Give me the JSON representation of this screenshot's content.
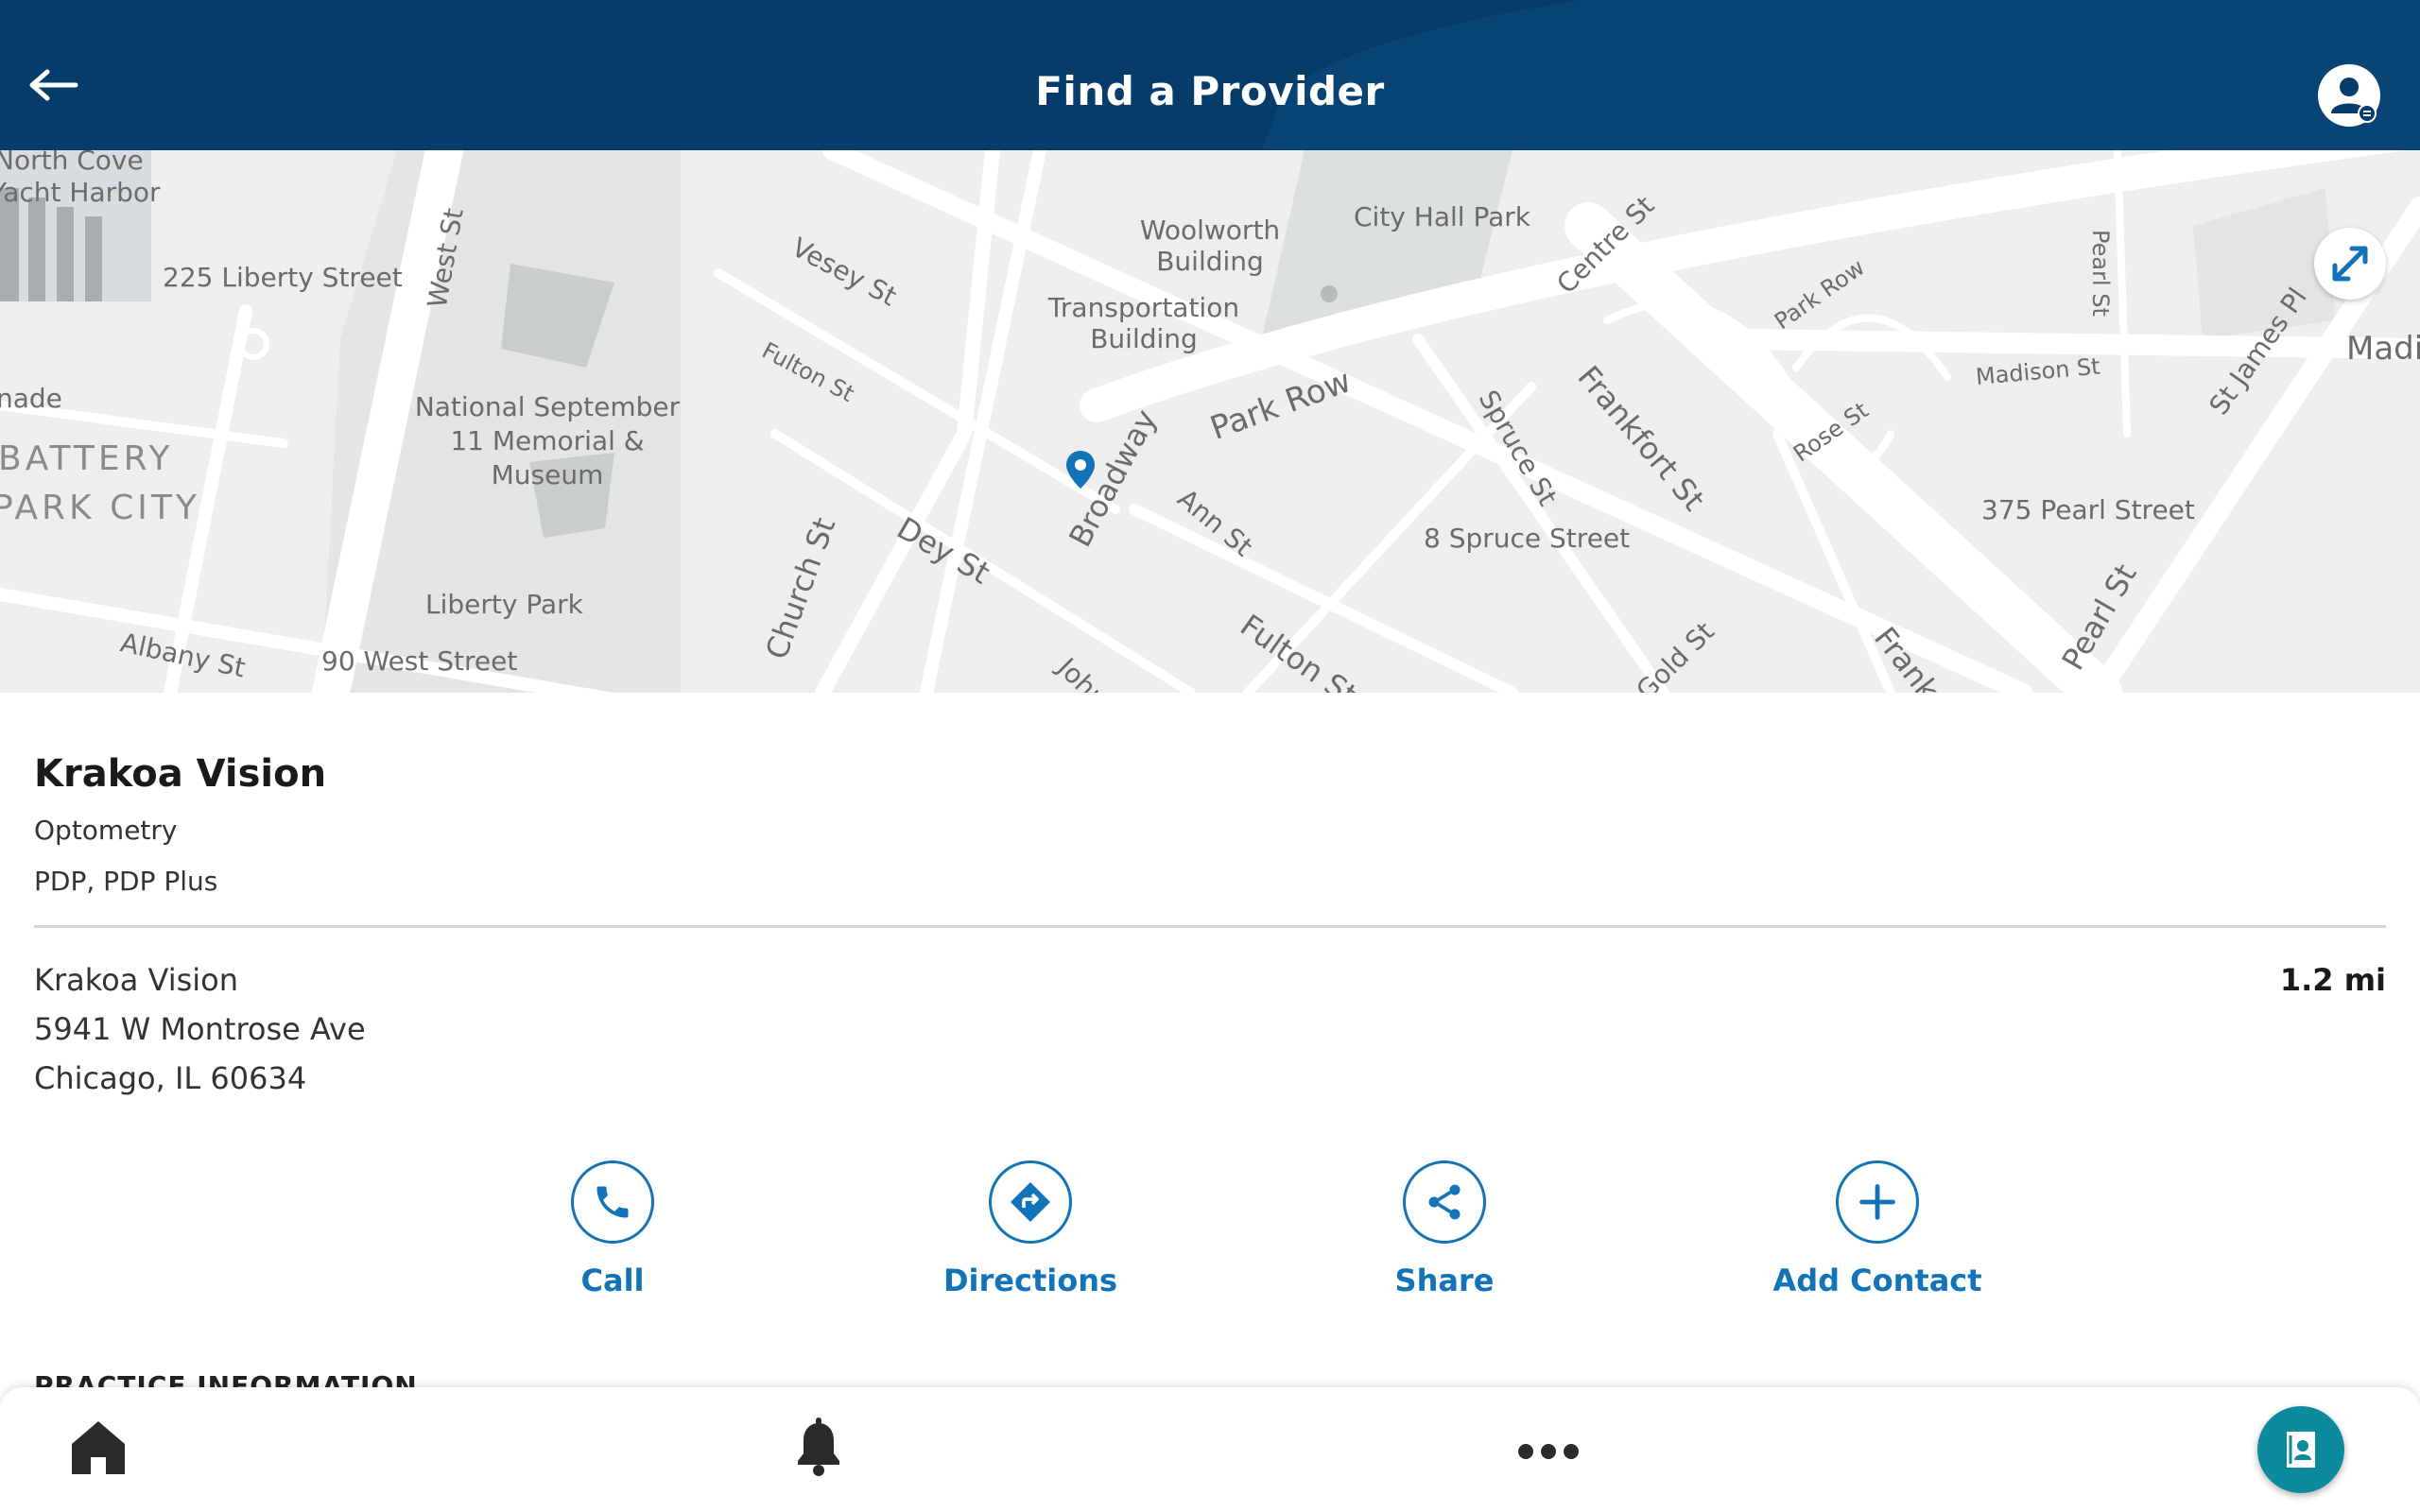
{
  "header": {
    "title": "Find a Provider"
  },
  "map": {
    "labels": {
      "north_cove": "North Cove",
      "yacht_harbor": "Yacht Harbor",
      "liberty_225": "225 Liberty Street",
      "west_st": "West St",
      "vesey_st": "Vesey St",
      "fulton_st_1": "Fulton St",
      "woolworth": "Woolworth Building",
      "transportation": "Transportation Building",
      "city_hall_park": "City Hall Park",
      "centre_st": "Centre St",
      "park_row_1": "Park Row",
      "park_row_2": "Park Row",
      "pearl_st_1": "Pearl St",
      "madison_st": "Madison St",
      "st_james": "St James Pl",
      "madi": "Madi",
      "frankfort_st_1": "Frankfort St",
      "rose_st": "Rose St",
      "spruce_st": "Spruce St",
      "nade": "nade",
      "battery": "BATTERY",
      "park_city": "PARK CITY",
      "memorial": "National September 11 Memorial & Museum",
      "liberty_park": "Liberty Park",
      "albany_st": "Albany St",
      "west_90": "90 West Street",
      "church_st": "Church St",
      "dey_st": "Dey St",
      "broadway": "Broadway",
      "ann_st": "Ann St",
      "spruce_8": "8 Spruce Street",
      "fulton_st_2": "Fulton St",
      "john": "John",
      "gold_st": "Gold St",
      "frankfort_2": "Frankfo",
      "pearl_375": "375 Pearl Street",
      "pearl_st_2": "Pearl St"
    }
  },
  "provider": {
    "name": "Krakoa Vision",
    "specialty": "Optometry",
    "networks": "PDP, PDP Plus",
    "location_name": "Krakoa Vision",
    "address_line1": "5941 W Montrose Ave",
    "address_line2": "Chicago, IL 60634",
    "distance": "1.2 mi"
  },
  "actions": {
    "call": "Call",
    "directions": "Directions",
    "share": "Share",
    "add_contact": "Add Contact"
  },
  "section": {
    "practice_info": "PRACTICE INFORMATION"
  },
  "icons": {
    "back": "arrow-left-icon",
    "profile": "user-profile-icon",
    "expand": "expand-icon",
    "pin": "map-pin-icon",
    "home": "home-icon",
    "bell": "bell-icon",
    "more": "more-icon",
    "id_card": "id-card-icon"
  },
  "colors": {
    "header_bg": "#053c6a",
    "accent": "#1273b8",
    "fab": "#0e8a9e"
  }
}
